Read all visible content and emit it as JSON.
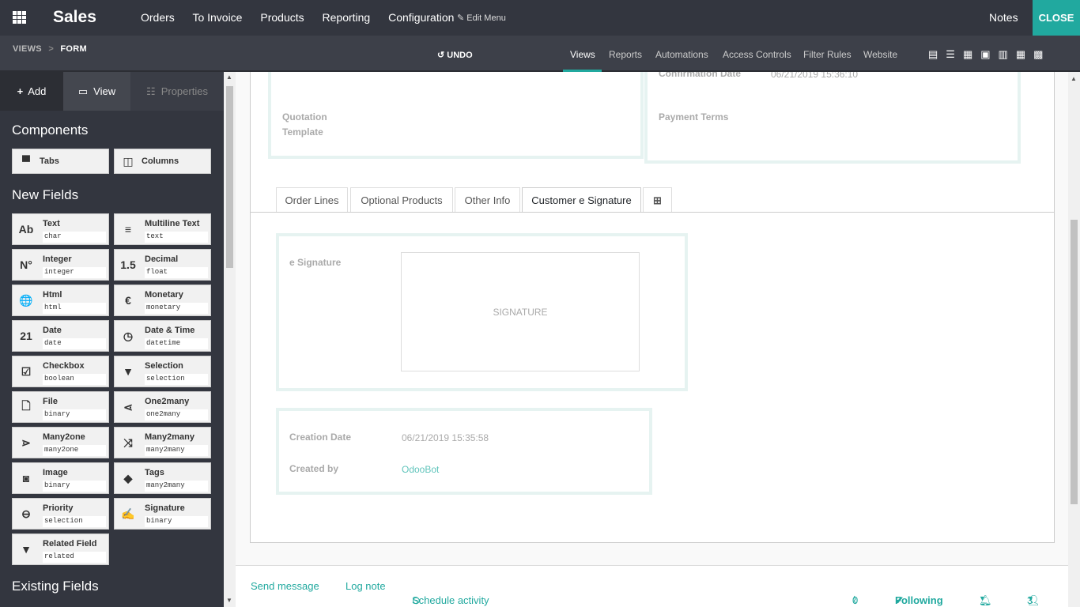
{
  "topbar": {
    "brand": "Sales",
    "menu": [
      "Orders",
      "To Invoice",
      "Products",
      "Reporting",
      "Configuration"
    ],
    "edit_menu": "Edit Menu",
    "notes": "Notes",
    "close": "CLOSE"
  },
  "subbar": {
    "crumb_views": "VIEWS",
    "crumb_sep": ">",
    "crumb_form": "FORM",
    "undo": "UNDO",
    "tabs": [
      "Views",
      "Reports",
      "Automations",
      "Access Controls",
      "Filter Rules",
      "Website"
    ]
  },
  "sidebar": {
    "tabs": {
      "add": "Add",
      "view": "View",
      "properties": "Properties"
    },
    "components_title": "Components",
    "components": [
      "Tabs",
      "Columns"
    ],
    "new_fields_title": "New Fields",
    "fields": [
      {
        "name": "Text",
        "type": "char",
        "icon": "Ab"
      },
      {
        "name": "Multiline Text",
        "type": "text",
        "icon": "≡"
      },
      {
        "name": "Integer",
        "type": "integer",
        "icon": "N°"
      },
      {
        "name": "Decimal",
        "type": "float",
        "icon": "1.5"
      },
      {
        "name": "Html",
        "type": "html",
        "icon": "🌐"
      },
      {
        "name": "Monetary",
        "type": "monetary",
        "icon": "€"
      },
      {
        "name": "Date",
        "type": "date",
        "icon": "21"
      },
      {
        "name": "Date & Time",
        "type": "datetime",
        "icon": "◷"
      },
      {
        "name": "Checkbox",
        "type": "boolean",
        "icon": "☑"
      },
      {
        "name": "Selection",
        "type": "selection",
        "icon": "▼"
      },
      {
        "name": "File",
        "type": "binary",
        "icon": "🗋"
      },
      {
        "name": "One2many",
        "type": "one2many",
        "icon": "⋖"
      },
      {
        "name": "Many2one",
        "type": "many2one",
        "icon": "⋗"
      },
      {
        "name": "Many2many",
        "type": "many2many",
        "icon": "⤨"
      },
      {
        "name": "Image",
        "type": "binary",
        "icon": "◙"
      },
      {
        "name": "Tags",
        "type": "many2many",
        "icon": "◆"
      },
      {
        "name": "Priority",
        "type": "selection",
        "icon": "⊖"
      },
      {
        "name": "Signature",
        "type": "binary",
        "icon": "✍"
      },
      {
        "name": "Related Field",
        "type": "related",
        "icon": "▼"
      }
    ],
    "existing_fields_title": "Existing Fields"
  },
  "form": {
    "confirmation_label": "Confirmation Date",
    "confirmation_value": "06/21/2019 15:36:10",
    "quotation_template_label": "Quotation Template",
    "payment_terms_label": "Payment Terms",
    "tabs": [
      "Order Lines",
      "Optional Products",
      "Other Info",
      "Customer e Signature"
    ],
    "signature_label": "e Signature",
    "signature_placeholder": "SIGNATURE",
    "creation_date_label": "Creation Date",
    "creation_date_value": "06/21/2019 15:35:58",
    "created_by_label": "Created by",
    "created_by_value": "OdooBot"
  },
  "chatter": {
    "send_message": "Send message",
    "log_note": "Log note",
    "schedule_activity": "Schedule activity",
    "attachments_count": "0",
    "following": "Following",
    "followers_count": "3"
  },
  "colors": {
    "accent": "#21a99f",
    "topbar": "#33363f"
  }
}
